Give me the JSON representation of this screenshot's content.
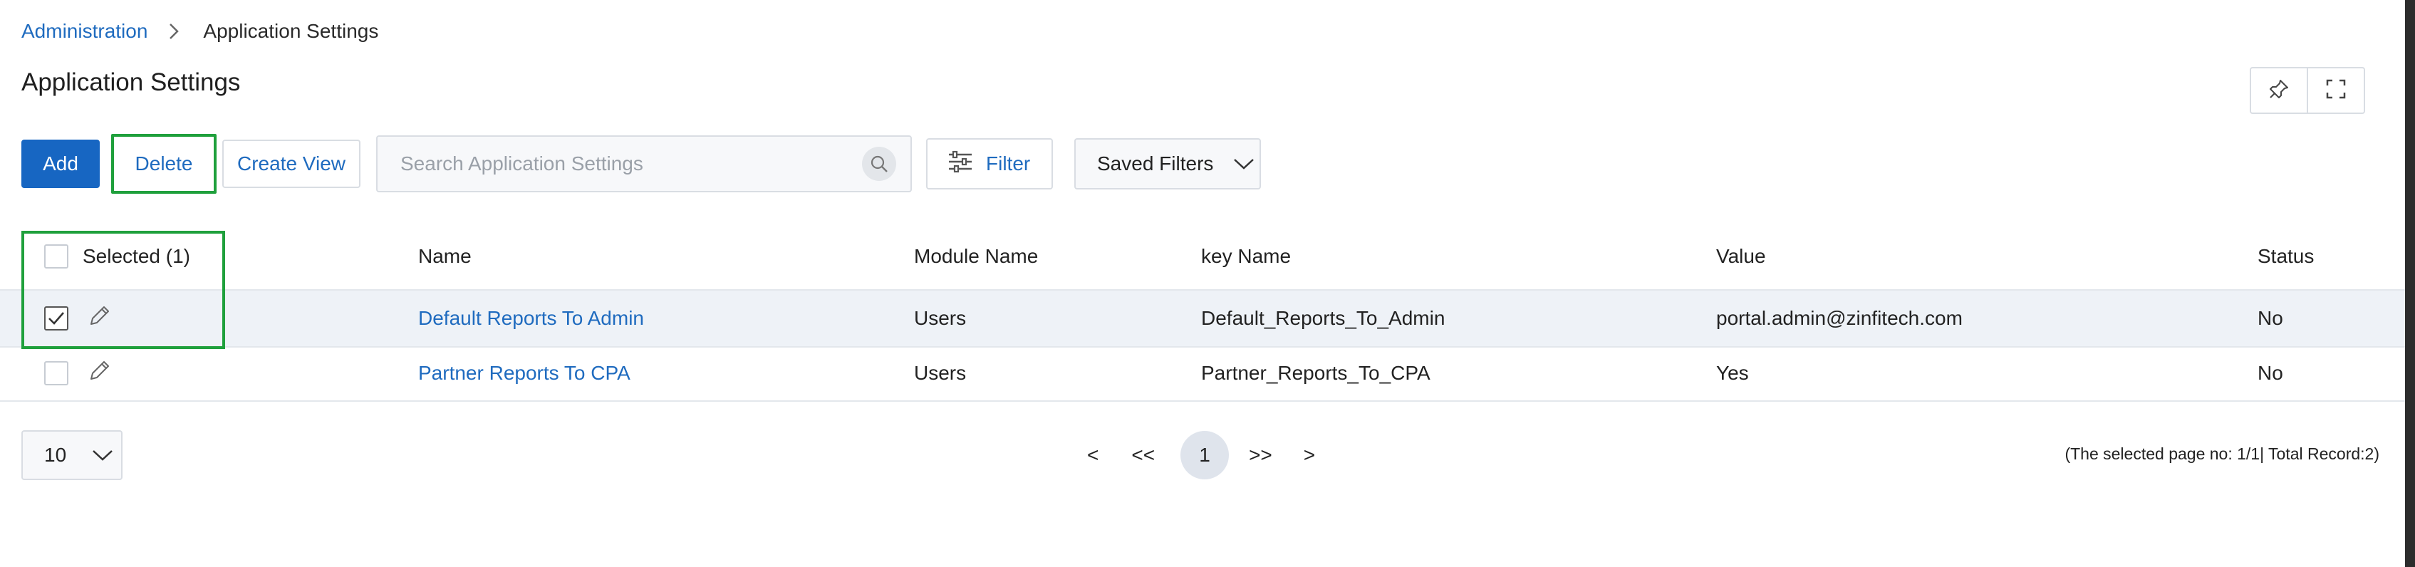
{
  "breadcrumb": {
    "parent": "Administration",
    "current": "Application Settings"
  },
  "page": {
    "title": "Application Settings"
  },
  "toolbar": {
    "add_label": "Add",
    "delete_label": "Delete",
    "create_view_label": "Create View",
    "search_placeholder": "Search Application Settings",
    "filter_label": "Filter",
    "saved_filters_label": "Saved Filters"
  },
  "table": {
    "headers": {
      "selected": "Selected (1)",
      "name": "Name",
      "module": "Module Name",
      "key": "key Name",
      "value": "Value",
      "status": "Status"
    },
    "rows": [
      {
        "checked": true,
        "name": "Default Reports To Admin",
        "module": "Users",
        "key": "Default_Reports_To_Admin",
        "value": "portal.admin@zinfitech.com",
        "status": "No"
      },
      {
        "checked": false,
        "name": "Partner Reports To CPA",
        "module": "Users",
        "key": "Partner_Reports_To_CPA",
        "value": "Yes",
        "status": "No"
      }
    ]
  },
  "pagination": {
    "page_size": "10",
    "prev": "<",
    "first": "<<",
    "current": "1",
    "last": ">>",
    "next": ">",
    "info": "(The selected page no: 1/1| Total Record:2)"
  },
  "colors": {
    "accent": "#1766c2",
    "link": "#1f6bbf",
    "highlight": "#1fa03c"
  }
}
